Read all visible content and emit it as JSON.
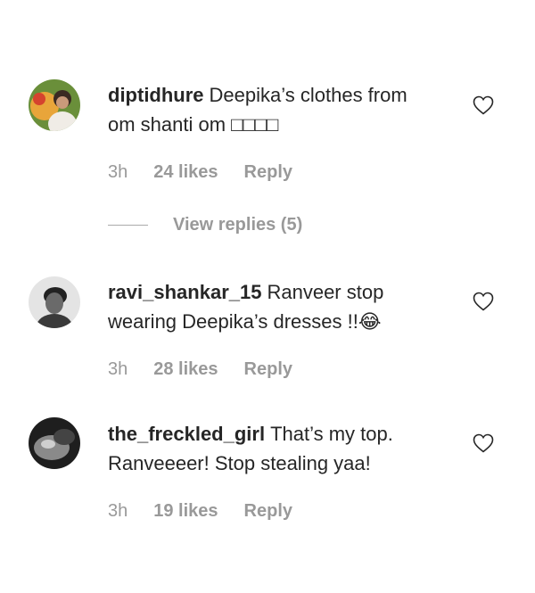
{
  "comments": [
    {
      "username": "diptidhure",
      "text": "Deepika’s clothes from om shanti om □□□□",
      "time": "3h",
      "likes": "24 likes",
      "reply": "Reply"
    },
    {
      "username": "ravi_shankar_15",
      "text": "Ranveer stop wearing Deepika’s dresses !!😂",
      "time": "3h",
      "likes": "28 likes",
      "reply": "Reply"
    },
    {
      "username": "the_freckled_girl",
      "text": "That’s my top. Ranveeeer! Stop stealing yaa!",
      "time": "3h",
      "likes": "19 likes",
      "reply": "Reply"
    }
  ],
  "view_replies": "View replies (5)",
  "icons": {
    "like": "heart-outline-icon"
  },
  "colors": {
    "text": "#262626",
    "muted": "#999999"
  }
}
